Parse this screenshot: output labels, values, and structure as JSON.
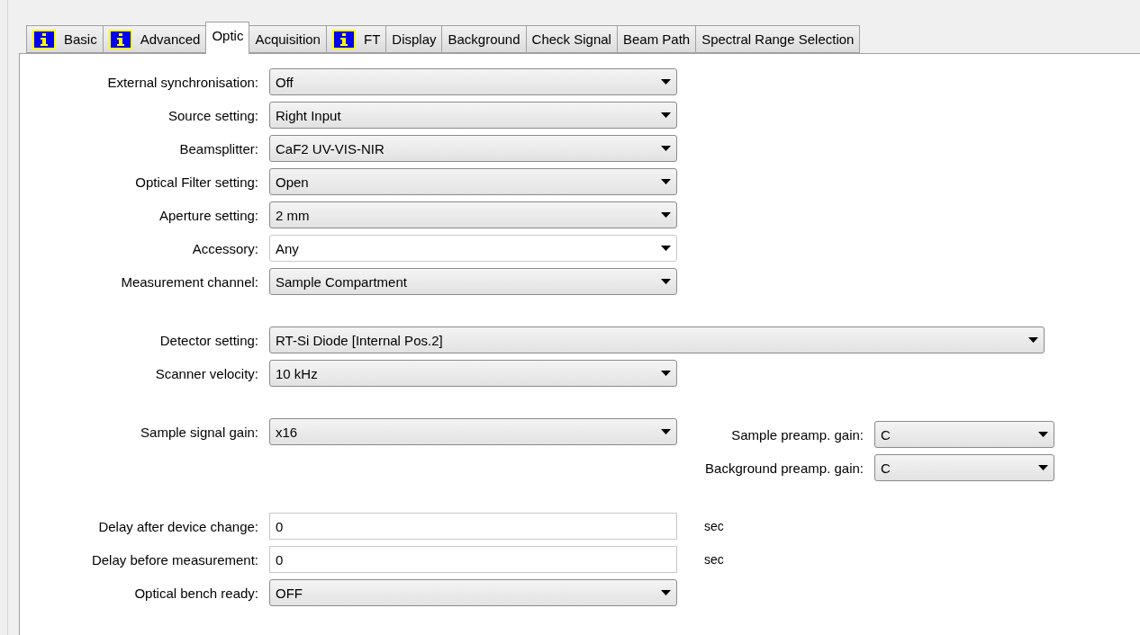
{
  "tabs": [
    {
      "label": "Basic",
      "info": true,
      "selected": false
    },
    {
      "label": "Advanced",
      "info": true,
      "selected": false
    },
    {
      "label": "Optic",
      "info": false,
      "selected": true
    },
    {
      "label": "Acquisition",
      "info": false,
      "selected": false
    },
    {
      "label": "FT",
      "info": true,
      "selected": false
    },
    {
      "label": "Display",
      "info": false,
      "selected": false
    },
    {
      "label": "Background",
      "info": false,
      "selected": false
    },
    {
      "label": "Check Signal",
      "info": false,
      "selected": false
    },
    {
      "label": "Beam Path",
      "info": false,
      "selected": false
    },
    {
      "label": "Spectral Range Selection",
      "info": false,
      "selected": false
    }
  ],
  "sections": [
    {
      "rows": [
        {
          "label": "External synchronisation:",
          "kind": "select",
          "value": "Off"
        },
        {
          "label": "Source setting:",
          "kind": "select",
          "value": "Right Input"
        },
        {
          "label": "Beamsplitter:",
          "kind": "select",
          "value": "CaF2 UV-VIS-NIR"
        },
        {
          "label": "Optical Filter setting:",
          "kind": "select",
          "value": "Open"
        },
        {
          "label": "Aperture setting:",
          "kind": "select",
          "value": "2 mm"
        },
        {
          "label": "Accessory:",
          "kind": "combo",
          "value": "Any"
        },
        {
          "label": "Measurement channel:",
          "kind": "select",
          "value": "Sample Compartment"
        }
      ]
    },
    {
      "rows": [
        {
          "label": "Detector setting:",
          "kind": "select",
          "value": "RT-Si Diode [Internal Pos.2]"
        },
        {
          "label": "Scanner velocity:",
          "kind": "select",
          "value": "10 kHz"
        }
      ]
    },
    {
      "rows": [
        {
          "label": "Sample signal gain:",
          "kind": "select",
          "value": "x16"
        }
      ],
      "side_rows": [
        {
          "label": "Sample preamp. gain:",
          "kind": "select",
          "value": "C"
        },
        {
          "label": "Background preamp. gain:",
          "kind": "select",
          "value": "C"
        }
      ]
    },
    {
      "rows": [
        {
          "label": "Delay after device change:",
          "kind": "text",
          "value": "0",
          "unit": "sec"
        },
        {
          "label": "Delay before measurement:",
          "kind": "text",
          "value": "0",
          "unit": "sec"
        },
        {
          "label": "Optical bench ready:",
          "kind": "select",
          "value": "OFF"
        }
      ]
    }
  ]
}
